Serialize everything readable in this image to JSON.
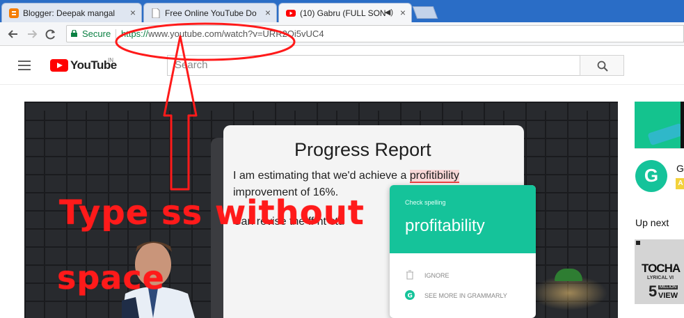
{
  "browser": {
    "tabs": [
      {
        "title": "Blogger: Deepak mangal",
        "favicon": "blogger-icon",
        "active": false
      },
      {
        "title": "Free Online YouTube Do",
        "favicon": "page-icon",
        "active": false
      },
      {
        "title": "(10) Gabru (FULL SON",
        "favicon": "youtube-icon",
        "active": true,
        "audio_icon": "speaker-icon"
      }
    ],
    "close_glyph": "×",
    "omnibox": {
      "secure_label": "Secure",
      "url_scheme": "https://",
      "url_rest": "www.youtube.com/watch?v=URR2Qi5vUC4"
    }
  },
  "youtube": {
    "logo_text": "YouTube",
    "region": "IN",
    "search_placeholder": "Search"
  },
  "video": {
    "doc_title": "Progress Report",
    "line1_pre": "I am estimating that we'd achieve a ",
    "line1_word": "profitibility",
    "line2": "improvement of 16%.",
    "line3": "Can    revise   the  ff    nt  ctu",
    "grammarly_check": "Check spelling",
    "grammarly_suggestion": "profitability",
    "grammarly_ignore": "IGNORE",
    "grammarly_more": "SEE MORE IN GRAMMARLY"
  },
  "sidebar": {
    "ad_badge_letter": "G",
    "ad_name": "G",
    "ad_tag": "A",
    "up_next_label": "Up next",
    "thumb_line1": "TOCHA",
    "thumb_line2": "LYRICAL VI",
    "thumb_line3": "5",
    "thumb_line4": "MILLION",
    "thumb_line5": "VIEW"
  },
  "annotation": {
    "line1": "Type  ss  without",
    "line2": "space",
    "color": "#ff1a1a"
  }
}
